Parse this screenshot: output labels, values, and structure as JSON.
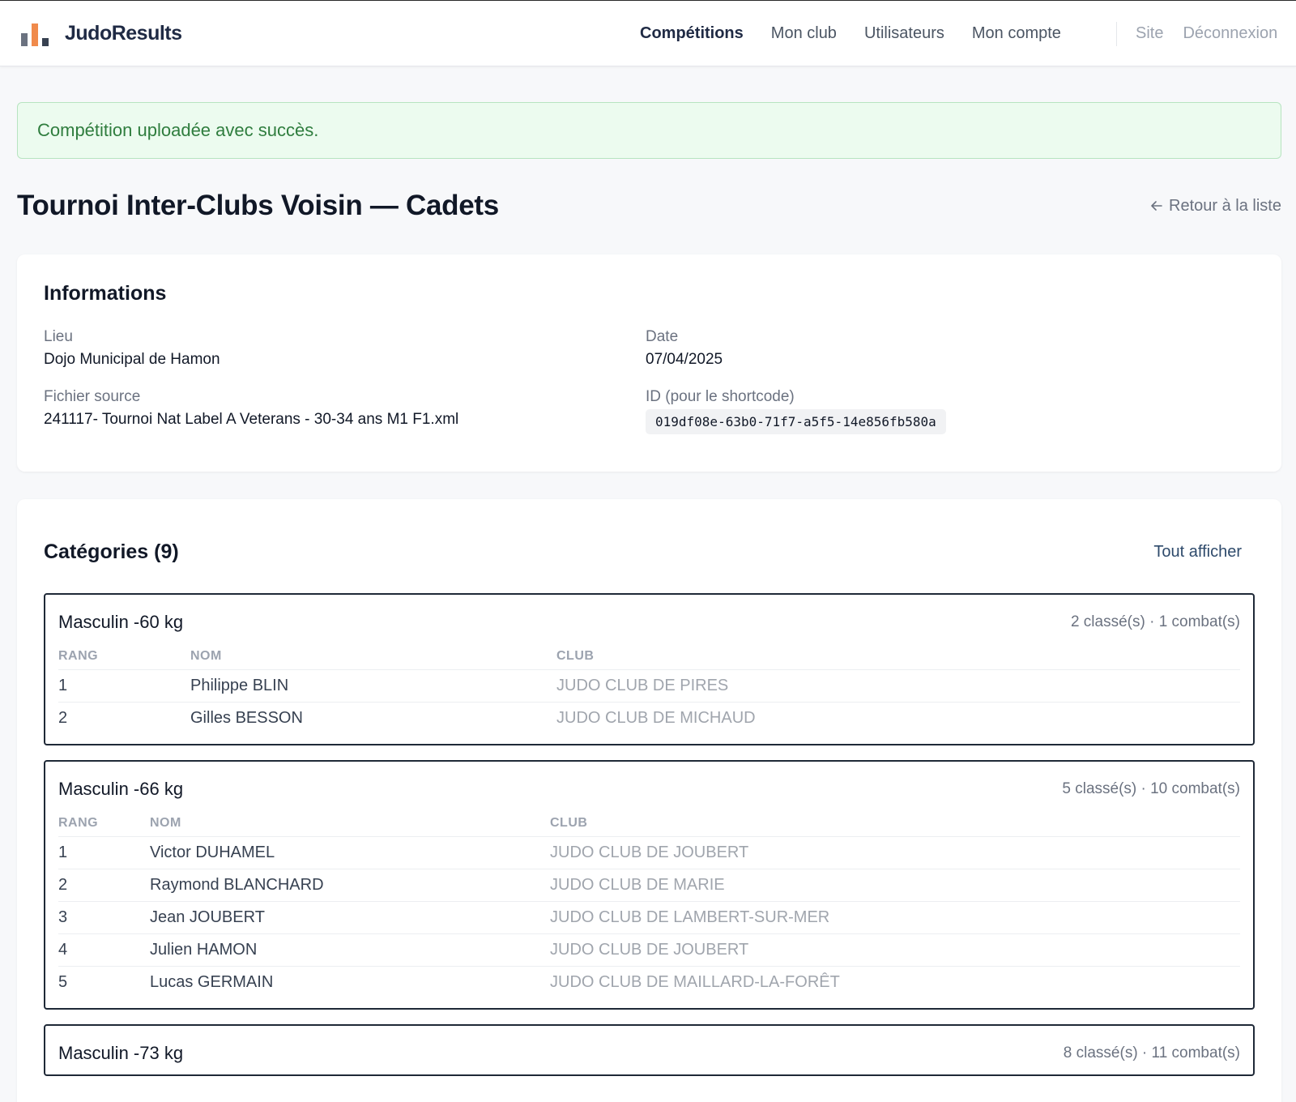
{
  "app": {
    "brand_name": "JudoResults"
  },
  "nav": {
    "main": [
      "Compétitions",
      "Mon club",
      "Utilisateurs",
      "Mon compte"
    ],
    "active": "Compétitions",
    "secondary": [
      "Site",
      "Déconnexion"
    ]
  },
  "alert": {
    "message": "Compétition uploadée avec succès.",
    "color": "#2f7d3e"
  },
  "page": {
    "title": "Tournoi Inter-Clubs Voisin — Cadets",
    "back_label": "Retour à la liste",
    "back_icon": "arrow-left-icon"
  },
  "info": {
    "title": "Informations",
    "lieu_label": "Lieu",
    "lieu_value": "Dojo Municipal de Hamon",
    "date_label": "Date",
    "date_value": "07/04/2025",
    "file_label": "Fichier source",
    "file_value": "241117- Tournoi Nat Label A Veterans - 30-34 ans M1 F1.xml",
    "id_label": "ID (pour le shortcode)",
    "id_value": "019df08e-63b0-71f7-a5f5-14e856fb580a"
  },
  "categories": {
    "title": "Catégories (9)",
    "show_all": "Tout afficher",
    "columns": [
      "RANG",
      "NOM",
      "CLUB"
    ],
    "items": [
      {
        "name": "Masculin -60 kg",
        "meta": "2 classé(s) · 1 combat(s)",
        "rows": [
          {
            "rank": "1",
            "name": "Philippe BLIN",
            "club": "JUDO CLUB DE PIRES"
          },
          {
            "rank": "2",
            "name": "Gilles BESSON",
            "club": "JUDO CLUB DE MICHAUD"
          }
        ]
      },
      {
        "name": "Masculin -66 kg",
        "meta": "5 classé(s) · 10 combat(s)",
        "rows": [
          {
            "rank": "1",
            "name": "Victor DUHAMEL",
            "club": "JUDO CLUB DE JOUBERT"
          },
          {
            "rank": "2",
            "name": "Raymond BLANCHARD",
            "club": "JUDO CLUB DE MARIE"
          },
          {
            "rank": "3",
            "name": "Jean JOUBERT",
            "club": "JUDO CLUB DE LAMBERT-SUR-MER"
          },
          {
            "rank": "4",
            "name": "Julien HAMON",
            "club": "JUDO CLUB DE JOUBERT"
          },
          {
            "rank": "5",
            "name": "Lucas GERMAIN",
            "club": "JUDO CLUB DE MAILLARD-LA-FORÊT"
          }
        ]
      },
      {
        "name": "Masculin -73 kg",
        "meta": "8 classé(s) · 11 combat(s)",
        "rows": []
      }
    ]
  }
}
